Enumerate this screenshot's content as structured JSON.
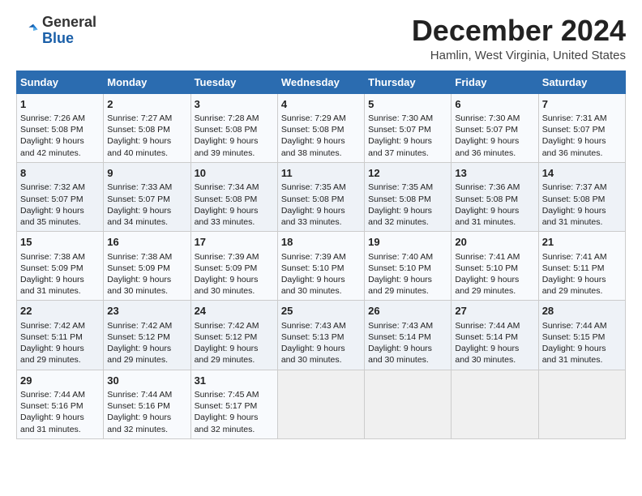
{
  "logo": {
    "line1": "General",
    "line2": "Blue"
  },
  "title": "December 2024",
  "subtitle": "Hamlin, West Virginia, United States",
  "days_of_week": [
    "Sunday",
    "Monday",
    "Tuesday",
    "Wednesday",
    "Thursday",
    "Friday",
    "Saturday"
  ],
  "weeks": [
    [
      {
        "day": 1,
        "sunrise": "Sunrise: 7:26 AM",
        "sunset": "Sunset: 5:08 PM",
        "daylight": "Daylight: 9 hours and 42 minutes."
      },
      {
        "day": 2,
        "sunrise": "Sunrise: 7:27 AM",
        "sunset": "Sunset: 5:08 PM",
        "daylight": "Daylight: 9 hours and 40 minutes."
      },
      {
        "day": 3,
        "sunrise": "Sunrise: 7:28 AM",
        "sunset": "Sunset: 5:08 PM",
        "daylight": "Daylight: 9 hours and 39 minutes."
      },
      {
        "day": 4,
        "sunrise": "Sunrise: 7:29 AM",
        "sunset": "Sunset: 5:08 PM",
        "daylight": "Daylight: 9 hours and 38 minutes."
      },
      {
        "day": 5,
        "sunrise": "Sunrise: 7:30 AM",
        "sunset": "Sunset: 5:07 PM",
        "daylight": "Daylight: 9 hours and 37 minutes."
      },
      {
        "day": 6,
        "sunrise": "Sunrise: 7:30 AM",
        "sunset": "Sunset: 5:07 PM",
        "daylight": "Daylight: 9 hours and 36 minutes."
      },
      {
        "day": 7,
        "sunrise": "Sunrise: 7:31 AM",
        "sunset": "Sunset: 5:07 PM",
        "daylight": "Daylight: 9 hours and 36 minutes."
      }
    ],
    [
      {
        "day": 8,
        "sunrise": "Sunrise: 7:32 AM",
        "sunset": "Sunset: 5:07 PM",
        "daylight": "Daylight: 9 hours and 35 minutes."
      },
      {
        "day": 9,
        "sunrise": "Sunrise: 7:33 AM",
        "sunset": "Sunset: 5:07 PM",
        "daylight": "Daylight: 9 hours and 34 minutes."
      },
      {
        "day": 10,
        "sunrise": "Sunrise: 7:34 AM",
        "sunset": "Sunset: 5:08 PM",
        "daylight": "Daylight: 9 hours and 33 minutes."
      },
      {
        "day": 11,
        "sunrise": "Sunrise: 7:35 AM",
        "sunset": "Sunset: 5:08 PM",
        "daylight": "Daylight: 9 hours and 33 minutes."
      },
      {
        "day": 12,
        "sunrise": "Sunrise: 7:35 AM",
        "sunset": "Sunset: 5:08 PM",
        "daylight": "Daylight: 9 hours and 32 minutes."
      },
      {
        "day": 13,
        "sunrise": "Sunrise: 7:36 AM",
        "sunset": "Sunset: 5:08 PM",
        "daylight": "Daylight: 9 hours and 31 minutes."
      },
      {
        "day": 14,
        "sunrise": "Sunrise: 7:37 AM",
        "sunset": "Sunset: 5:08 PM",
        "daylight": "Daylight: 9 hours and 31 minutes."
      }
    ],
    [
      {
        "day": 15,
        "sunrise": "Sunrise: 7:38 AM",
        "sunset": "Sunset: 5:09 PM",
        "daylight": "Daylight: 9 hours and 31 minutes."
      },
      {
        "day": 16,
        "sunrise": "Sunrise: 7:38 AM",
        "sunset": "Sunset: 5:09 PM",
        "daylight": "Daylight: 9 hours and 30 minutes."
      },
      {
        "day": 17,
        "sunrise": "Sunrise: 7:39 AM",
        "sunset": "Sunset: 5:09 PM",
        "daylight": "Daylight: 9 hours and 30 minutes."
      },
      {
        "day": 18,
        "sunrise": "Sunrise: 7:39 AM",
        "sunset": "Sunset: 5:10 PM",
        "daylight": "Daylight: 9 hours and 30 minutes."
      },
      {
        "day": 19,
        "sunrise": "Sunrise: 7:40 AM",
        "sunset": "Sunset: 5:10 PM",
        "daylight": "Daylight: 9 hours and 29 minutes."
      },
      {
        "day": 20,
        "sunrise": "Sunrise: 7:41 AM",
        "sunset": "Sunset: 5:10 PM",
        "daylight": "Daylight: 9 hours and 29 minutes."
      },
      {
        "day": 21,
        "sunrise": "Sunrise: 7:41 AM",
        "sunset": "Sunset: 5:11 PM",
        "daylight": "Daylight: 9 hours and 29 minutes."
      }
    ],
    [
      {
        "day": 22,
        "sunrise": "Sunrise: 7:42 AM",
        "sunset": "Sunset: 5:11 PM",
        "daylight": "Daylight: 9 hours and 29 minutes."
      },
      {
        "day": 23,
        "sunrise": "Sunrise: 7:42 AM",
        "sunset": "Sunset: 5:12 PM",
        "daylight": "Daylight: 9 hours and 29 minutes."
      },
      {
        "day": 24,
        "sunrise": "Sunrise: 7:42 AM",
        "sunset": "Sunset: 5:12 PM",
        "daylight": "Daylight: 9 hours and 29 minutes."
      },
      {
        "day": 25,
        "sunrise": "Sunrise: 7:43 AM",
        "sunset": "Sunset: 5:13 PM",
        "daylight": "Daylight: 9 hours and 30 minutes."
      },
      {
        "day": 26,
        "sunrise": "Sunrise: 7:43 AM",
        "sunset": "Sunset: 5:14 PM",
        "daylight": "Daylight: 9 hours and 30 minutes."
      },
      {
        "day": 27,
        "sunrise": "Sunrise: 7:44 AM",
        "sunset": "Sunset: 5:14 PM",
        "daylight": "Daylight: 9 hours and 30 minutes."
      },
      {
        "day": 28,
        "sunrise": "Sunrise: 7:44 AM",
        "sunset": "Sunset: 5:15 PM",
        "daylight": "Daylight: 9 hours and 31 minutes."
      }
    ],
    [
      {
        "day": 29,
        "sunrise": "Sunrise: 7:44 AM",
        "sunset": "Sunset: 5:16 PM",
        "daylight": "Daylight: 9 hours and 31 minutes."
      },
      {
        "day": 30,
        "sunrise": "Sunrise: 7:44 AM",
        "sunset": "Sunset: 5:16 PM",
        "daylight": "Daylight: 9 hours and 32 minutes."
      },
      {
        "day": 31,
        "sunrise": "Sunrise: 7:45 AM",
        "sunset": "Sunset: 5:17 PM",
        "daylight": "Daylight: 9 hours and 32 minutes."
      },
      null,
      null,
      null,
      null
    ]
  ]
}
